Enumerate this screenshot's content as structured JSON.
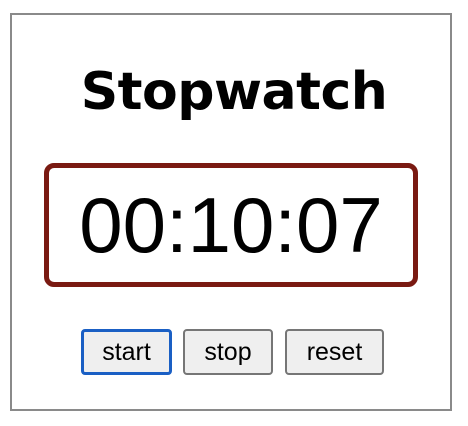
{
  "app": {
    "title": "Stopwatch"
  },
  "timer": {
    "display": "00:10:07"
  },
  "controls": {
    "start_label": "start",
    "stop_label": "stop",
    "reset_label": "reset",
    "focused": "start"
  },
  "colors": {
    "display_border": "#7a1a12",
    "focus_ring": "#1a5fc4",
    "button_bg": "#efefef",
    "frame_border": "#8a8a8a"
  }
}
